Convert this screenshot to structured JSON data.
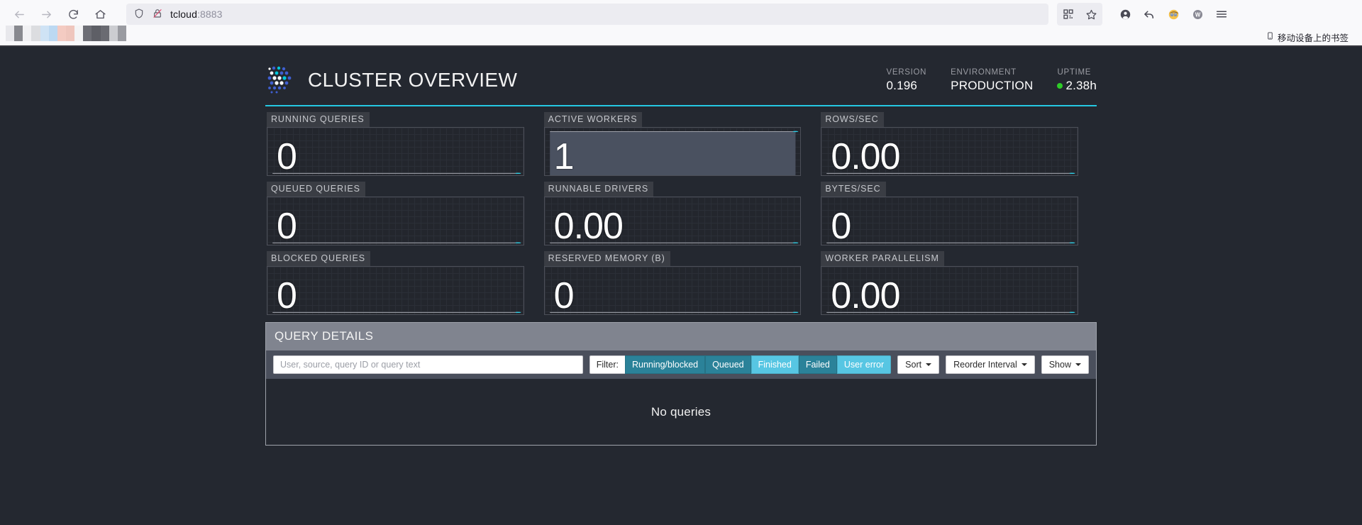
{
  "browser": {
    "url_host": "tcloud",
    "url_port": ":8883",
    "back_icon": "back-arrow-icon",
    "forward_icon": "forward-arrow-icon",
    "reload_icon": "reload-icon",
    "home_icon": "home-icon",
    "shield_icon": "shield-icon",
    "insecure_icon": "insecure-lock-icon",
    "qr_icon": "qr-code-icon",
    "star_icon": "star-icon",
    "account_icon": "account-icon",
    "undo_icon": "undo-arrow-icon",
    "emoji_icon": "emoji-face-icon",
    "w_icon": "w-circle-icon",
    "menu_icon": "hamburger-menu-icon",
    "bookmark_label": "移动设备上的书签",
    "bookmark_icon": "mobile-device-icon"
  },
  "header": {
    "title": "CLUSTER OVERVIEW",
    "logo_icon": "trino-dots-logo",
    "stats": [
      {
        "label": "VERSION",
        "value": "0.196"
      },
      {
        "label": "ENVIRONMENT",
        "value": "PRODUCTION"
      },
      {
        "label": "UPTIME",
        "value": "2.38h"
      }
    ],
    "uptime_status_color": "#2ecc28",
    "accent_color": "#25c8e2"
  },
  "tiles": [
    {
      "label": "RUNNING QUERIES",
      "value": "0",
      "fill": false
    },
    {
      "label": "ACTIVE WORKERS",
      "value": "1",
      "fill": true
    },
    {
      "label": "ROWS/SEC",
      "value": "0.00",
      "fill": false
    },
    {
      "label": "QUEUED QUERIES",
      "value": "0",
      "fill": false
    },
    {
      "label": "RUNNABLE DRIVERS",
      "value": "0.00",
      "fill": false
    },
    {
      "label": "BYTES/SEC",
      "value": "0",
      "fill": false
    },
    {
      "label": "BLOCKED QUERIES",
      "value": "0",
      "fill": false
    },
    {
      "label": "RESERVED MEMORY (B)",
      "value": "0",
      "fill": false
    },
    {
      "label": "WORKER PARALLELISM",
      "value": "0.00",
      "fill": false
    }
  ],
  "chart_data": {
    "type": "line",
    "title": "Cluster metric sparklines",
    "xlabel": "",
    "ylabel": "",
    "grid": true,
    "legend": "none",
    "series": [
      {
        "name": "RUNNING QUERIES",
        "values": [
          0,
          0,
          0,
          0,
          0,
          0,
          0,
          0,
          0,
          0,
          0,
          0
        ],
        "current": 0,
        "filled": false
      },
      {
        "name": "ACTIVE WORKERS",
        "values": [
          1,
          1,
          1,
          1,
          1,
          1,
          1,
          1,
          1,
          1,
          1,
          1
        ],
        "current": 1,
        "filled": true
      },
      {
        "name": "ROWS/SEC",
        "values": [
          0,
          0,
          0,
          0,
          0,
          0,
          0,
          0,
          0,
          0,
          0,
          0
        ],
        "current": 0.0,
        "filled": false
      },
      {
        "name": "QUEUED QUERIES",
        "values": [
          0,
          0,
          0,
          0,
          0,
          0,
          0,
          0,
          0,
          0,
          0,
          0
        ],
        "current": 0,
        "filled": false
      },
      {
        "name": "RUNNABLE DRIVERS",
        "values": [
          0,
          0,
          0,
          0,
          0,
          0,
          0,
          0,
          0,
          0,
          0,
          0
        ],
        "current": 0.0,
        "filled": false
      },
      {
        "name": "BYTES/SEC",
        "values": [
          0,
          0,
          0,
          0,
          0,
          0,
          0,
          0,
          0,
          0,
          0,
          0
        ],
        "current": 0,
        "filled": false
      },
      {
        "name": "BLOCKED QUERIES",
        "values": [
          0,
          0,
          0,
          0,
          0,
          0,
          0,
          0,
          0,
          0,
          0,
          0
        ],
        "current": 0,
        "filled": false
      },
      {
        "name": "RESERVED MEMORY (B)",
        "values": [
          0,
          0,
          0,
          0,
          0,
          0,
          0,
          0,
          0,
          0,
          0,
          0
        ],
        "current": 0,
        "filled": false
      },
      {
        "name": "WORKER PARALLELISM",
        "values": [
          0,
          0,
          0,
          0,
          0,
          0,
          0,
          0,
          0,
          0,
          0,
          0
        ],
        "current": 0.0,
        "filled": false
      }
    ],
    "line_color": "#b9bcc4",
    "point_color": "#2fd3ea",
    "fill_color": "#4a5160"
  },
  "query_details": {
    "title": "QUERY DETAILS",
    "search_placeholder": "User, source, query ID or query text",
    "search_value": "",
    "filter_label": "Filter:",
    "filters": [
      {
        "label": "Running/blocked",
        "active": true
      },
      {
        "label": "Queued",
        "active": true
      },
      {
        "label": "Finished",
        "active": false
      },
      {
        "label": "Failed",
        "active": true
      },
      {
        "label": "User error",
        "active": false
      }
    ],
    "dropdowns": [
      {
        "label": "Sort"
      },
      {
        "label": "Reorder Interval"
      },
      {
        "label": "Show"
      }
    ],
    "empty_message": "No queries",
    "active_color": "#2b8299",
    "inactive_color": "#57c6e3"
  }
}
